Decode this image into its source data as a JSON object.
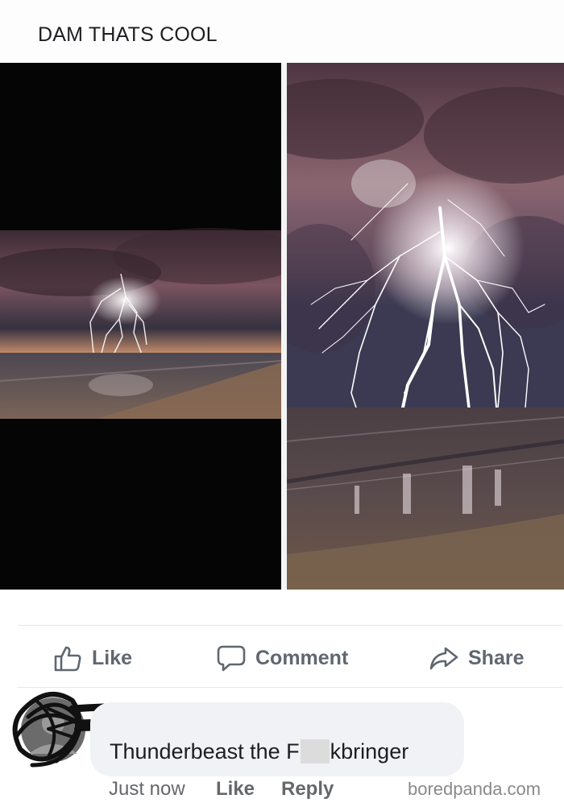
{
  "post": {
    "text": "DAM THATS COOL"
  },
  "photos": [
    {
      "description_icon": "lightning-beach-photo"
    },
    {
      "description_icon": "lightning-beach-photo-zoomed"
    }
  ],
  "actions": {
    "like": "Like",
    "comment": "Comment",
    "share": "Share"
  },
  "comment": {
    "text_before": "Thunderbeast the F",
    "text_after": "kbringer",
    "time": "Just now",
    "like": "Like",
    "reply": "Reply"
  },
  "watermark": "boredpanda.com",
  "colors": {
    "action_grey": "#606770",
    "bubble": "#f0f2f5",
    "sky": "#6e4a55",
    "bolt": "#ffffff"
  }
}
